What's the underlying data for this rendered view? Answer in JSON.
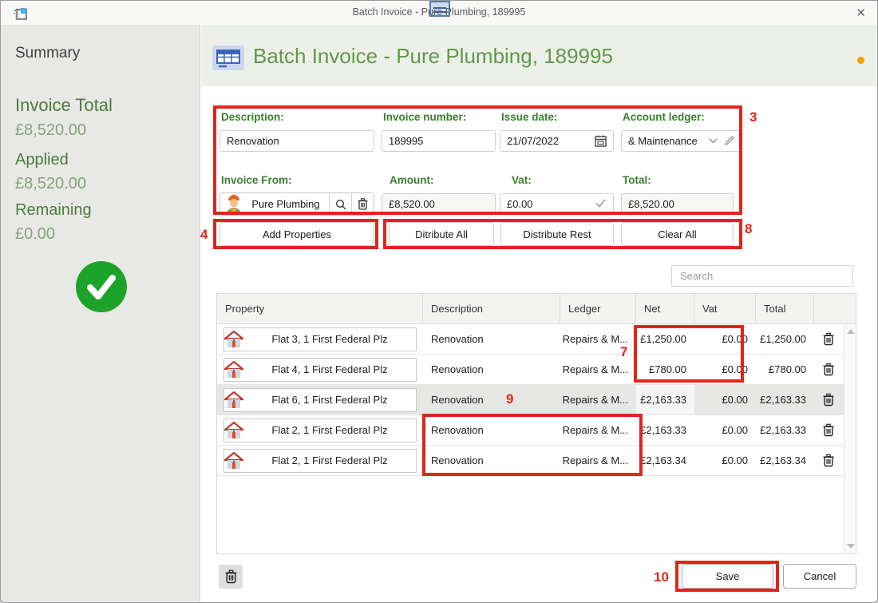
{
  "window": {
    "title": "Batch Invoice  - Pure Plumbing, 189995",
    "close_glyph": "✕"
  },
  "sidebar": {
    "heading": "Summary",
    "items": [
      {
        "label": "Invoice Total",
        "value": "£8,520.00"
      },
      {
        "label": "Applied",
        "value": "£8,520.00"
      },
      {
        "label": "Remaining",
        "value": "£0.00"
      }
    ]
  },
  "header": {
    "title": "Batch Invoice  - Pure Plumbing, 189995"
  },
  "form": {
    "description": {
      "label": "Description:",
      "value": "Renovation"
    },
    "invoice_number": {
      "label": "Invoice number:",
      "value": "189995"
    },
    "issue_date": {
      "label": "Issue date:",
      "value": "21/07/2022"
    },
    "account_ledger": {
      "label": "Account ledger:",
      "value": "& Maintenance"
    },
    "invoice_from": {
      "label": "Invoice From:",
      "value": "Pure Plumbing"
    },
    "amount": {
      "label": "Amount:",
      "value": "£8,520.00"
    },
    "vat": {
      "label": "Vat:",
      "value": "£0.00"
    },
    "total": {
      "label": "Total:",
      "value": "£8,520.00"
    }
  },
  "actions": {
    "add_properties": "Add Properties",
    "distribute_all": "Ditribute All",
    "distribute_rest": "Distribute Rest",
    "clear_all": "Clear All"
  },
  "search": {
    "placeholder": "Search"
  },
  "table": {
    "columns": [
      "Property",
      "Description",
      "Ledger",
      "Net",
      "Vat",
      "Total"
    ],
    "rows": [
      {
        "property": "Flat 3, 1 First Federal Plz",
        "description": "Renovation",
        "ledger": "Repairs & M...",
        "net": "£1,250.00",
        "vat": "£0.00",
        "total": "£1,250.00"
      },
      {
        "property": "Flat 4, 1 First Federal Plz",
        "description": "Renovation",
        "ledger": "Repairs & M...",
        "net": "£780.00",
        "vat": "£0.00",
        "total": "£780.00"
      },
      {
        "property": "Flat 6, 1 First Federal Plz",
        "description": "Renovation",
        "ledger": "Repairs & M...",
        "net": "£2,163.33",
        "vat": "£0.00",
        "total": "£2,163.33"
      },
      {
        "property": "Flat 2, 1 First Federal Plz",
        "description": "Renovation",
        "ledger": "Repairs & M...",
        "net": "£2,163.33",
        "vat": "£0.00",
        "total": "£2,163.33"
      },
      {
        "property": "Flat 2, 1 First Federal Plz",
        "description": "Renovation",
        "ledger": "Repairs & M...",
        "net": "£2,163.34",
        "vat": "£0.00",
        "total": "£2,163.34"
      }
    ]
  },
  "footer": {
    "save": "Save",
    "cancel": "Cancel"
  },
  "annotations": {
    "color": "#e1251b",
    "n3": "3",
    "n4": "4",
    "n7": "7",
    "n8": "8",
    "n9": "9",
    "n10": "10"
  },
  "icons": {
    "accent_orange_dot": "#f2a200",
    "success_green": "#1ea32a"
  }
}
